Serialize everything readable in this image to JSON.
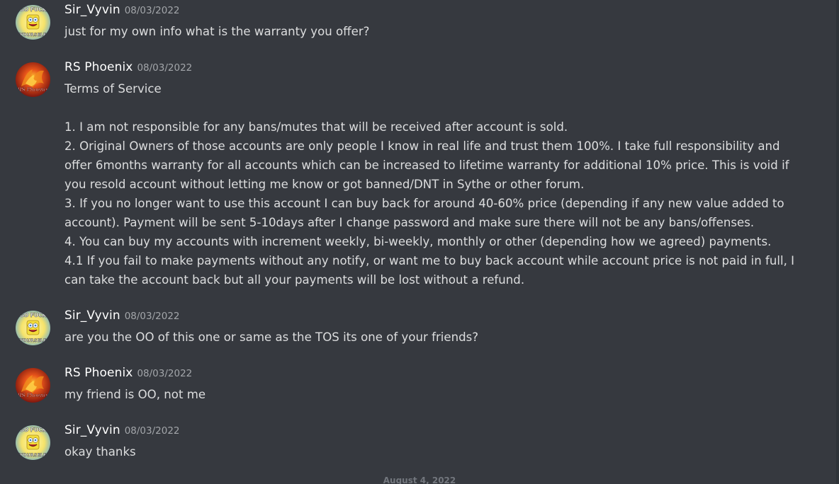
{
  "messages": [
    {
      "username": "Sir_Vyvin",
      "timestamp": "08/03/2022",
      "avatar": "spongebob-avatar",
      "avatar_text_top": "GO FUCK",
      "avatar_text_bottom": "YOURSELF",
      "lines": [
        "just for my own info what is the warranty you offer?"
      ]
    },
    {
      "username": "RS Phoenix",
      "timestamp": "08/03/2022",
      "avatar": "phoenix-avatar",
      "avatar_text": "RS Phoenix",
      "lines": [
        "Terms of Service",
        "",
        "1. I am not responsible for any bans/mutes that will be received after account is sold.",
        "2. Original Owners of those accounts are only people I know in real life and trust them 100%. I take full responsibility and",
        "offer 6months warranty for all accounts which can be increased to lifetime warranty for additional 10% price. This is void if",
        "you resold account without letting me know or got banned/DNT in Sythe or other forum.",
        "3. If you no longer want to use this account I can buy back for around 40-60% price (depending if any new value added to",
        "account). Payment will be sent 5-10days after I change password and make sure there will not be any bans/offenses.",
        "4. You can buy my accounts with increment weekly, bi-weekly, monthly or other (depending how we agreed) payments.",
        "4.1 If you fail to make payments without any notify, or want me to buy back account while account price is not paid in full, I",
        "can take the account back but all your payments will be lost without a refund."
      ]
    },
    {
      "username": "Sir_Vyvin",
      "timestamp": "08/03/2022",
      "avatar": "spongebob-avatar",
      "avatar_text_top": "GO FUCK",
      "avatar_text_bottom": "YOURSELF",
      "lines": [
        "are you the OO of this one or same as the TOS its one of your friends?"
      ]
    },
    {
      "username": "RS Phoenix",
      "timestamp": "08/03/2022",
      "avatar": "phoenix-avatar",
      "avatar_text": "RS Phoenix",
      "lines": [
        "my friend is OO, not me"
      ]
    },
    {
      "username": "Sir_Vyvin",
      "timestamp": "08/03/2022",
      "avatar": "spongebob-avatar",
      "avatar_text_top": "GO FUCK",
      "avatar_text_bottom": "YOURSELF",
      "lines": [
        "okay thanks"
      ]
    }
  ],
  "date_divider": "August 4, 2022",
  "colors": {
    "background": "#36393f",
    "username": "#ffffff",
    "timestamp": "#a3a6aa",
    "message_text": "#dcddde",
    "divider_text": "#72767d"
  }
}
